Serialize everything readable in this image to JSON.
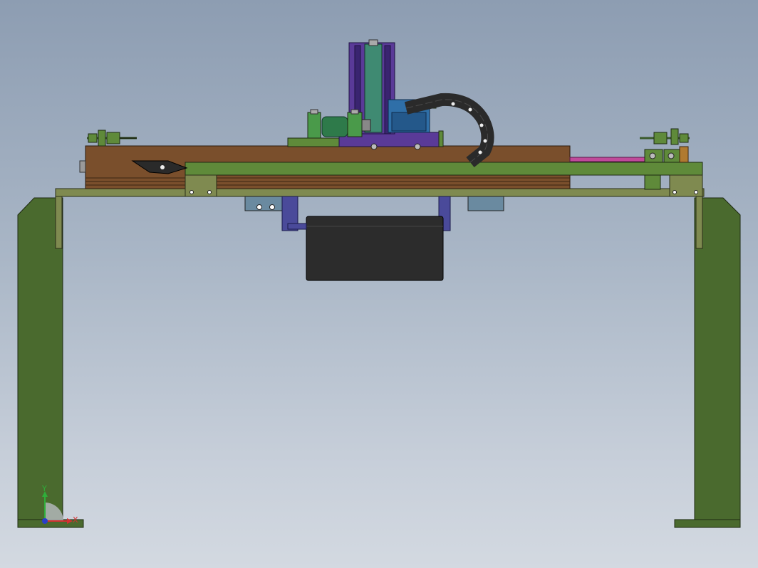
{
  "view": {
    "background_top": "#8d9db2",
    "background_bottom": "#d3d9e1"
  },
  "colors": {
    "frame_green": "#4a6a2e",
    "rail_olive": "#7f8a50",
    "beam_brown": "#7a4f2c",
    "slide_green": "#5f8a3a",
    "motor_black": "#2c2c2c",
    "column_purple": "#5a3a98",
    "column_teal": "#3f8a72",
    "block_blue": "#2f6fa8",
    "cable_chain": "#2a2a2a",
    "rod_magenta": "#c04a9a"
  },
  "triad": {
    "y_label": "Y",
    "x_label": "X",
    "y_color": "#2fae3a",
    "x_color": "#d43030",
    "z_color": "#2a3fc8"
  }
}
